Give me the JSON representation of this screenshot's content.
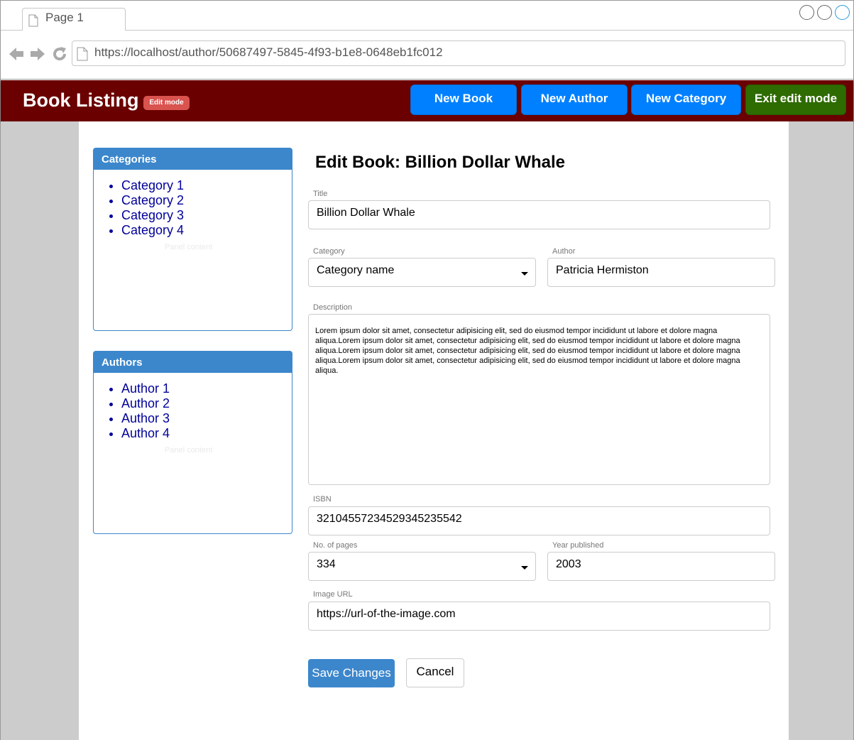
{
  "browser": {
    "tab_label": "Page 1",
    "url": "https://localhost/author/50687497-5845-4f93-b1e8-0648eb1fc012"
  },
  "header": {
    "brand": "Book Listing",
    "badge": "Edit mode",
    "buttons": {
      "new_book": "New Book",
      "new_author": "New Author",
      "new_category": "New Category",
      "exit_edit": "Exit edit mode"
    }
  },
  "sidebar": {
    "categories": {
      "title": "Categories",
      "items": [
        "Category 1",
        "Category 2",
        "Category 3",
        "Category 4"
      ],
      "ghost": "Panel content"
    },
    "authors": {
      "title": "Authors",
      "items": [
        "Author 1",
        "Author 2",
        "Author 3",
        "Author 4"
      ],
      "ghost": "Panel content"
    }
  },
  "form": {
    "heading": "Edit Book: Billion Dollar Whale",
    "title": {
      "label": "Title",
      "value": "Billion Dollar Whale"
    },
    "category": {
      "label": "Category",
      "value": "Category name"
    },
    "author": {
      "label": "Author",
      "value": "Patricia Hermiston"
    },
    "description": {
      "label": "Description",
      "value": "Lorem ipsum dolor sit amet, consectetur adipisicing elit, sed do eiusmod tempor incididunt ut labore et dolore magna aliqua.Lorem ipsum dolor sit amet, consectetur adipisicing elit, sed do eiusmod tempor incididunt ut labore et dolore magna aliqua.Lorem ipsum dolor sit amet, consectetur adipisicing elit, sed do eiusmod tempor incididunt ut labore et dolore magna aliqua.Lorem ipsum dolor sit amet, consectetur adipisicing elit, sed do eiusmod tempor incididunt ut labore et dolore magna aliqua."
    },
    "isbn": {
      "label": "ISBN",
      "value": "32104557234529345235542"
    },
    "pages": {
      "label": "No. of pages",
      "value": "334"
    },
    "year": {
      "label": "Year published",
      "value": "2003"
    },
    "image_url": {
      "label": "Image URL",
      "value": "https://url-of-the-image.com"
    },
    "save_label": "Save Changes",
    "cancel_label": "Cancel"
  },
  "colors": {
    "header_bg": "#6a0000",
    "primary_blue": "#0080ff",
    "exit_green": "#2e6b00",
    "badge_red": "#d9534f",
    "panel_blue": "#3c87cc"
  }
}
